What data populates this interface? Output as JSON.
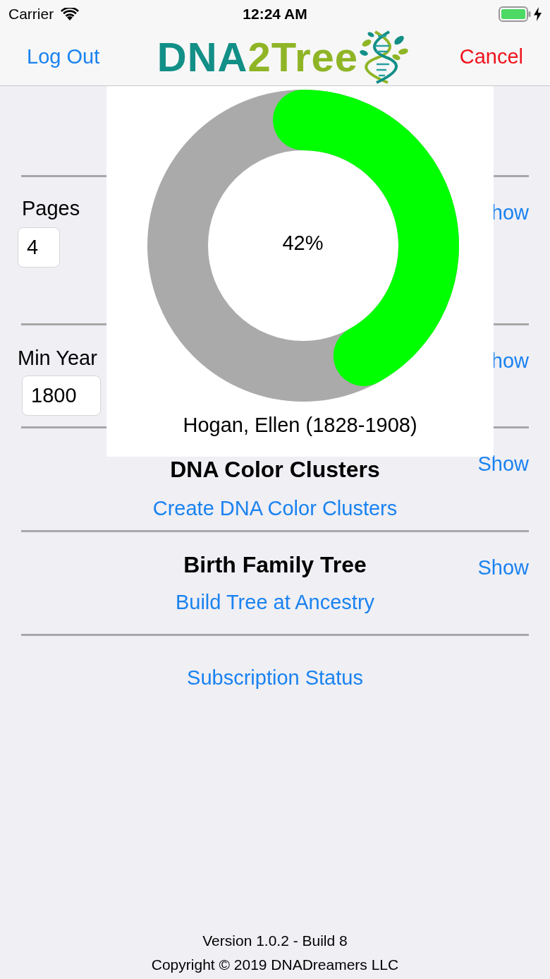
{
  "status_bar": {
    "carrier": "Carrier",
    "time": "12:24 AM",
    "charging": true
  },
  "nav_bar": {
    "left_button": "Log Out",
    "right_button": "Cancel",
    "logo": [
      "DNA",
      "2Tree"
    ]
  },
  "sections": [
    {
      "kind": "field",
      "label": "Pages",
      "value": "4",
      "show": "how"
    },
    {
      "kind": "field",
      "label": "Min Year",
      "value": "1800",
      "show": "how"
    },
    {
      "kind": "feature",
      "title": "DNA Color Clusters",
      "show": "Show",
      "link": "Create DNA Color Clusters"
    },
    {
      "kind": "feature",
      "title": "Birth Family Tree",
      "show": "Show",
      "link": "Build Tree at Ancestry"
    }
  ],
  "subscription_link": "Subscription Status",
  "footer": {
    "version": "Version 1.0.2 - Build 8",
    "copyright": "Copyright © 2019 DNADreamers LLC"
  },
  "progress_popup": {
    "reading": "42%",
    "name": "Hogan, Ellen (1828-1908)"
  }
}
